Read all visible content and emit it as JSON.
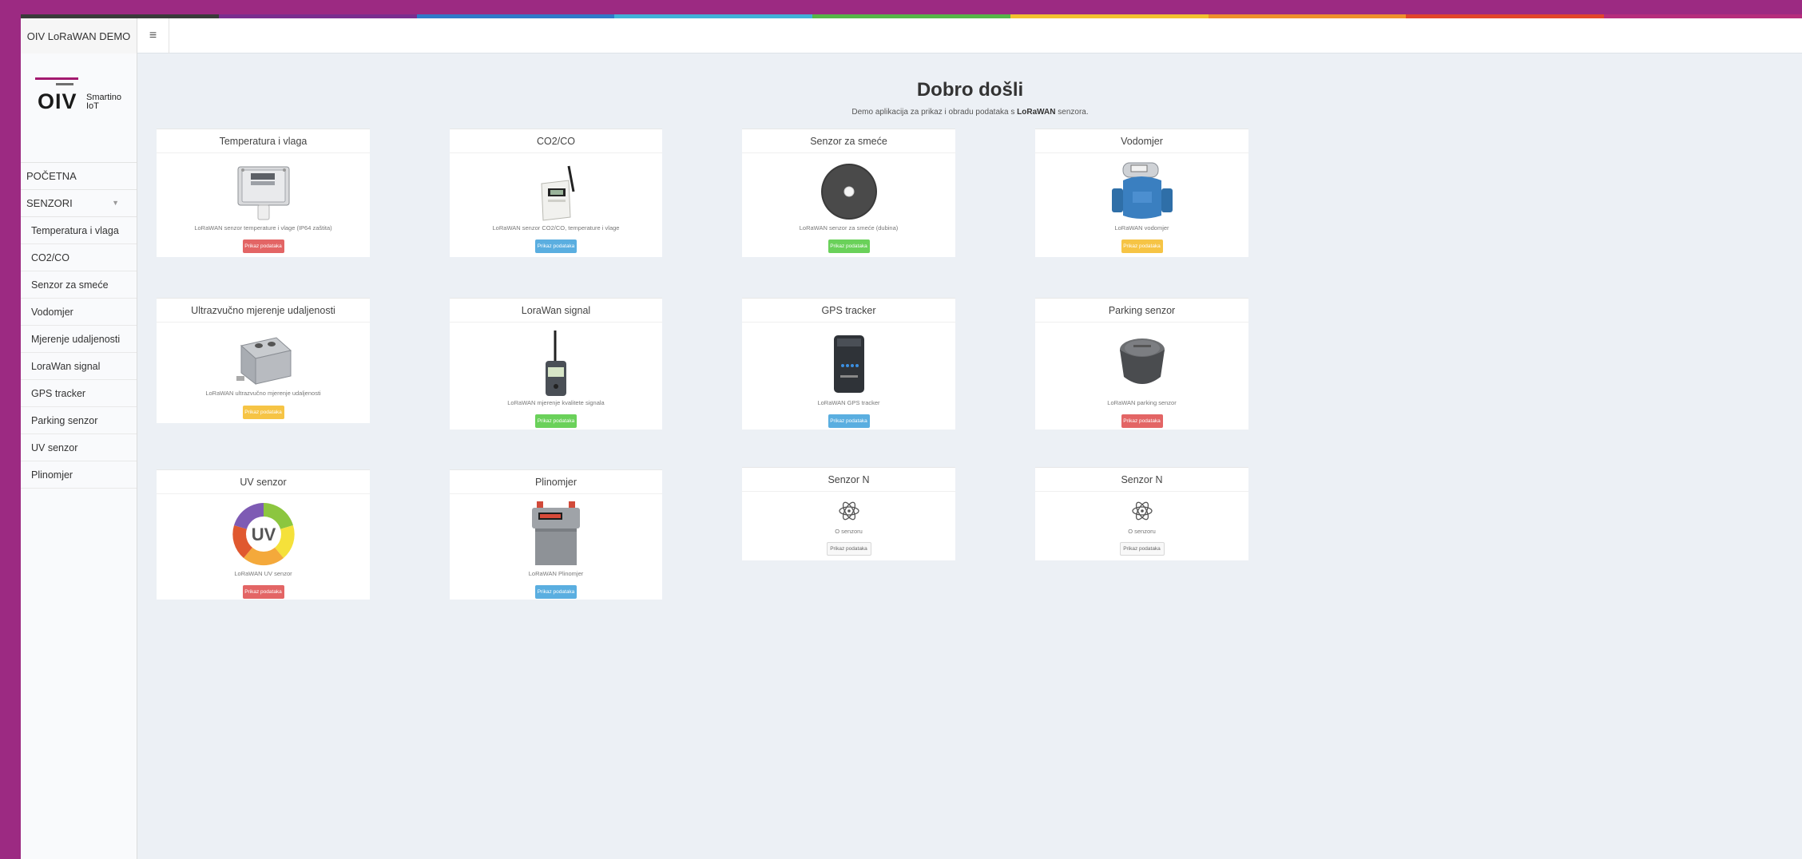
{
  "app": {
    "brand": "OIV LoRaWAN DEMO"
  },
  "logo": {
    "text": "OIV",
    "small_line1": "Smartino",
    "small_line2": "IoT"
  },
  "colors": {
    "frame": "#9c2a82",
    "rainbow": [
      "#3a3a3a",
      "#7a2e8e",
      "#2f79c9",
      "#40b1d8",
      "#56b548",
      "#f2c12e",
      "#ee8f2b",
      "#e2452b",
      "#b62d7c"
    ]
  },
  "sidebar": {
    "items": [
      {
        "label": "POČETNA"
      },
      {
        "label": "SENZORI"
      },
      {
        "label": "Temperatura i vlaga"
      },
      {
        "label": "CO2/CO"
      },
      {
        "label": "Senzor za smeće"
      },
      {
        "label": "Vodomjer"
      },
      {
        "label": "Mjerenje udaljenosti"
      },
      {
        "label": "LoraWan signal"
      },
      {
        "label": "GPS tracker"
      },
      {
        "label": "Parking senzor"
      },
      {
        "label": "UV senzor"
      },
      {
        "label": "Plinomjer"
      }
    ]
  },
  "main": {
    "title": "Dobro došli",
    "subtitle_pre": "Demo aplikacija za prikaz i obradu podataka s ",
    "subtitle_bold": "LoRaWAN",
    "subtitle_post": " senzora.",
    "cards": [
      {
        "title": "Temperatura i vlaga",
        "desc": "LoRaWAN senzor temperature i vlage (IP64 zaštita)",
        "button": "Prikaz podataka",
        "icon": "temperature-sensor-image"
      },
      {
        "title": "CO2/CO",
        "desc": "LoRaWAN senzor CO2/CO, temperature i vlage",
        "button": "Prikaz podataka",
        "icon": "co2-sensor-image"
      },
      {
        "title": "Senzor za smeće",
        "desc": "LoRaWAN senzor za smeće (dubina)",
        "button": "Prikaz podataka",
        "icon": "waste-sensor-image"
      },
      {
        "title": "Vodomjer",
        "desc": "LoRaWAN vodomjer",
        "button": "Prikaz podataka",
        "icon": "water-meter-image"
      },
      {
        "title": "Ultrazvučno mjerenje udaljenosti",
        "desc": "LoRaWAN ultrazvučno mjerenje udaljenosti",
        "button": "Prikaz podataka",
        "icon": "ultrasonic-sensor-image"
      },
      {
        "title": "LoraWan signal",
        "desc": "LoRaWAN mjerenje kvalitete signala",
        "button": "Prikaz podataka",
        "icon": "signal-tester-image"
      },
      {
        "title": "GPS tracker",
        "desc": "LoRaWAN GPS tracker",
        "button": "Prikaz podataka",
        "icon": "gps-tracker-image"
      },
      {
        "title": "Parking senzor",
        "desc": "LoRaWAN parking senzor",
        "button": "Prikaz podataka",
        "icon": "parking-sensor-image"
      },
      {
        "title": "UV senzor",
        "desc": "LoRaWAN UV senzor",
        "button": "Prikaz podataka",
        "icon": "uv-sensor-image",
        "uv_label": "UV"
      },
      {
        "title": "Plinomjer",
        "desc": "LoRaWAN Plinomjer",
        "button": "Prikaz podataka",
        "icon": "gas-meter-image"
      },
      {
        "title": "Senzor N",
        "desc": "O senzoru",
        "button": "Prikaz podataka",
        "icon": "atom-icon"
      },
      {
        "title": "Senzor N",
        "desc": "O senzoru",
        "button": "Prikaz podataka",
        "icon": "atom-icon"
      }
    ]
  }
}
